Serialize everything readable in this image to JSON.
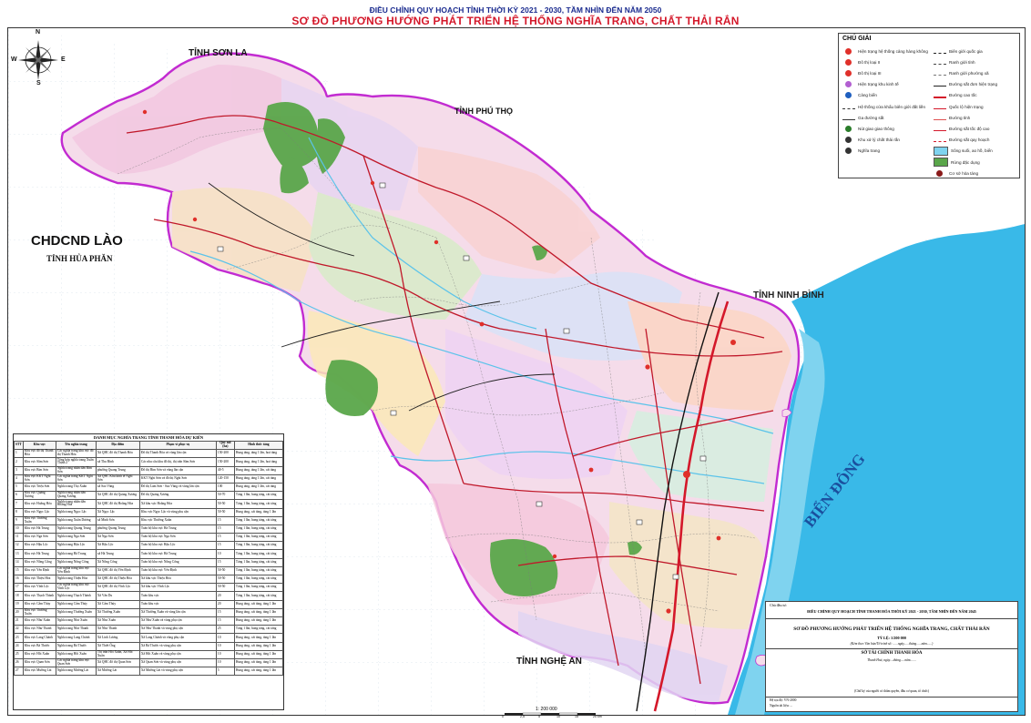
{
  "header": {
    "title": "ĐIỀU CHỈNH QUY HOẠCH TỈNH THỜI KỲ 2021 - 2030, TẦM NHÌN ĐẾN NĂM 2050",
    "subtitle": "SƠ ĐỒ PHƯƠNG HƯỚNG PHÁT TRIỂN HỆ THỐNG NGHĨA TRANG, CHẤT THẢI RẮN"
  },
  "map_labels": {
    "son_la": "TỈNH SƠN LA",
    "phu_tho": "TỈNH PHÚ THỌ",
    "lao": "CHDCND LÀO",
    "hua_phan": "TỈNH HỦA PHĂN",
    "ninh_binh": "TỈNH NINH BÌNH",
    "nghe_an": "TỈNH NGHỆ AN",
    "bien_dong": "BIỂN ĐÔNG"
  },
  "compass": {
    "n": "N",
    "s": "S",
    "e": "E",
    "w": "W"
  },
  "legend": {
    "heading": "CHÚ GIẢI",
    "items_left": [
      {
        "label": "Hiện trạng hệ thống cảng hàng không",
        "icon": "airport-icon",
        "color": "#e0302a"
      },
      {
        "label": "Đô thị loại II",
        "icon": "urban-type-ii-icon",
        "color": "#e0302a"
      },
      {
        "label": "Đô thị loại III",
        "icon": "urban-type-iii-icon",
        "color": "#e0302a"
      },
      {
        "label": "Hiện trạng khu kinh tế",
        "icon": "economic-zone-icon",
        "color": "#b25fd1"
      },
      {
        "label": "Cảng biển",
        "icon": "seaport-icon",
        "color": "#1f5fbf"
      },
      {
        "label": "Hệ thống cửa khẩu biên giới đất liền",
        "icon": "border-gate-icon",
        "color": "#333333"
      },
      {
        "label": "Ga đường sắt",
        "icon": "railway-station-icon",
        "color": "#333333"
      },
      {
        "label": "Nút giao giao thông",
        "icon": "interchange-icon",
        "color": "#2a7d2a"
      },
      {
        "label": "Khu xử lý chất thải rắn",
        "icon": "waste-treatment-icon",
        "color": "#333333"
      },
      {
        "label": "Nghĩa trang",
        "icon": "cemetery-icon",
        "color": "#333333"
      }
    ],
    "items_right": [
      {
        "label": "Biên giới quốc gia",
        "icon": "national-border-icon",
        "color": "#222222"
      },
      {
        "label": "Ranh giới tỉnh",
        "icon": "province-border-icon",
        "color": "#444444"
      },
      {
        "label": "Ranh giới phường xã",
        "icon": "commune-border-icon",
        "color": "#777777"
      },
      {
        "label": "Đường sắt đơn hiện trạng",
        "icon": "single-railway-icon",
        "color": "#222222"
      },
      {
        "label": "Đường cao tốc",
        "icon": "expressway-icon",
        "color": "#d4182a"
      },
      {
        "label": "Quốc lộ hiện trạng",
        "icon": "national-road-icon",
        "color": "#d4182a"
      },
      {
        "label": "Đường tỉnh",
        "icon": "provincial-road-icon",
        "color": "#e05050"
      },
      {
        "label": "Đường sắt tốc độ cao",
        "icon": "high-speed-rail-icon",
        "color": "#d4182a"
      },
      {
        "label": "Đường sắt quy hoạch",
        "icon": "planned-railway-icon",
        "color": "#d4182a"
      },
      {
        "label": "Sông suối, ao hồ, biển",
        "icon": "water-icon",
        "color": "#7fd3ef"
      },
      {
        "label": "Rừng đặc dụng",
        "icon": "special-forest-icon",
        "color": "#5aa64a"
      },
      {
        "label": "Cơ sở hỏa táng",
        "icon": "crematorium-icon",
        "color": "#8a1a1a"
      }
    ]
  },
  "cemetery_table": {
    "caption": "DANH MỤC NGHĨA TRANG TỈNH THANH HÓA DỰ KIẾN",
    "headers": [
      "STT",
      "Khu vực",
      "Tên nghĩa trang",
      "Địa điểm",
      "Phạm vi phục vụ",
      "Quy mô (ha)",
      "Hình thức táng"
    ],
    "rows": [
      [
        "1",
        "Khu vực đô thị Thanh Hóa",
        "Các nghĩa trang khu vực đô thị Thanh Hóa",
        "Xã QHC đô thị Thanh Hóa",
        "Đô thị Thanh Hóa và vùng lân cận",
        "150-200",
        "Hung táng, táng 1 lần, hoả táng"
      ],
      [
        "2",
        "Khu vực Sầm Sơn",
        "Tổng hợp nghĩa trang Xuân Thịnh 2",
        "xã Thu Bình",
        "Các nhu cầu khu đô thị, thị trấn Sầm Sơn",
        "150-200",
        "Hung táng, táng 1 lần, hoả táng"
      ],
      [
        "3",
        "Khu vực Bỉm Sơn",
        "Nghĩa trang nhân dân Bỉm Sơn",
        "phường Quang Trung",
        "Đô thị Bỉm Sơn và vùng lân cận",
        "40-5",
        "Hung táng, táng 1 lần, cát táng"
      ],
      [
        "4",
        "Khu vực KKT Nghi Sơn",
        "Các nghĩa trang KKT Nghi Sơn",
        "Xã QHC Khu kinh tế Nghi Sơn",
        "KKT Nghi Sơn và đô thị Nghi Sơn",
        "120-150",
        "Hung táng, táng 1 lần, cát táng"
      ],
      [
        "5",
        "Khu vực Triệu Sơn",
        "Nghĩa trang Thọ Xuân",
        "xã Sao Vàng",
        "Đô thị Lam Sơn - Sao Vàng và vùng lân cận",
        "100",
        "Hung táng, táng 1 lần, cát táng"
      ],
      [
        "6",
        "Khu vực Quảng Xương",
        "Nghĩa trang nhân dân Quảng Xương",
        "Xã QHC đô thị Quảng Xương",
        "Đô thị Quảng Xương",
        "50-70",
        "Táng 1 lần, hung táng, cát táng"
      ],
      [
        "7",
        "Khu vực Hoằng Hóa",
        "Nghĩa trang nhân dân Hoằng Hóa",
        "Xã QHC đô thị Hoằng Hóa",
        "Xã khu vực Hoằng Hóa",
        "50-50",
        "Táng 1 lần, hung táng, cát táng"
      ],
      [
        "8",
        "Khu vực Ngọc Lặc",
        "Nghĩa trang Ngọc Lặc",
        "Xã Ngọc Lặc",
        "Khu vực Ngọc Lặc và vùng phụ cận",
        "50-50",
        "Hung táng, cát táng, táng 1 lần"
      ],
      [
        "9",
        "Khu vực Thường Xuân",
        "Nghĩa trang Xuân Dương",
        "xã Minh Sơn",
        "Khu vực Thường Xuân",
        "15",
        "Táng 1 lần, hung táng, cát táng"
      ],
      [
        "10",
        "Khu vực Hà Trung",
        "Nghĩa trang Quang Trung",
        "phường Quang Trung",
        "Toàn bộ khu vực Hà Trung",
        "15",
        "Táng 1 lần, hung táng, cát táng"
      ],
      [
        "11",
        "Khu vực Nga Sơn",
        "Nghĩa trang Nga Sơn",
        "Xã Nga Sơn",
        "Toàn bộ khu vực Nga Sơn",
        "15",
        "Táng 1 lần, hung táng, cát táng"
      ],
      [
        "12",
        "Khu vực Hậu Lộc",
        "Nghĩa trang Hậu Lộc",
        "Xã Hậu Lộc",
        "Toàn bộ khu vực Hậu Lộc",
        "15",
        "Táng 1 lần, hung táng, cát táng"
      ],
      [
        "13",
        "Khu vực Hà Trung",
        "Nghĩa trang Hà Trung",
        "xã Hà Trung",
        "Toàn bộ khu vực Hà Trung",
        "10",
        "Táng 1 lần, hung táng, cát táng"
      ],
      [
        "14",
        "Khu vực Nông Cống",
        "Nghĩa trang Nông Cống",
        "Xã Nông Cống",
        "Toàn bộ khu vực Nông Cống",
        "15",
        "Táng 1 lần, hung táng, cát táng"
      ],
      [
        "15",
        "Khu vực Yên Định",
        "Các nghĩa trang khu vực Yên Định",
        "Xã QHC đô thị Yên Định",
        "Toàn bộ khu vực Yên Định",
        "50-50",
        "Táng 1 lần, hung táng, cát táng"
      ],
      [
        "16",
        "Khu vực Thiệu Hóa",
        "Nghĩa trang Thiệu Hóa",
        "Xã QHC đô thị Thiệu Hóa",
        "Xã khu vực Thiệu Hóa",
        "50-50",
        "Táng 1 lần, hung táng, cát táng"
      ],
      [
        "17",
        "Khu vực Vĩnh Lộc",
        "Các nghĩa trang khu vực Vĩnh Lộc",
        "Xã QHC đô thị Vĩnh Lộc",
        "Xã khu vực Vĩnh Lộc",
        "50-50",
        "Táng 1 lần, hung táng, cát táng"
      ],
      [
        "18",
        "Khu vực Thạch Thành",
        "Nghĩa trang Thạch Thành",
        "Xã Vân Du",
        "Toàn khu vực",
        "20",
        "Táng 1 lần, hung táng, cát táng"
      ],
      [
        "19",
        "Khu vực Cẩm Thủy",
        "Nghĩa trang Cẩm Thủy",
        "Xã Cẩm Thủy",
        "Toàn khu vực",
        "20",
        "Hung táng, cát táng, táng 1 lần"
      ],
      [
        "20",
        "Khu vực Thường Xuân",
        "Nghĩa trang Thường Xuân",
        "Xã Thường Xuân",
        "Xã Thường Xuân và vùng lân cận",
        "15",
        "Hung táng, cát táng, táng 1 lần"
      ],
      [
        "21",
        "Khu vực Như Xuân",
        "Nghĩa trang Như Xuân",
        "Xã Như Xuân",
        "Xã Như Xuân và vùng phụ cận",
        "15",
        "Hung táng, cát táng, táng 1 lần"
      ],
      [
        "22",
        "Khu vực Như Thanh",
        "Nghĩa trang Như Thanh",
        "Xã Như Thanh",
        "Xã Như Thanh và vùng phụ cận",
        "25",
        "Táng 1 lần, hung táng, cát táng"
      ],
      [
        "23",
        "Khu vực Lang Chánh",
        "Nghĩa trang Lang Chánh",
        "Xã Linh Lương",
        "Xã Lang Chánh và vùng phụ cận",
        "10",
        "Hung táng, cát táng, táng 1 lần"
      ],
      [
        "24",
        "Khu vực Bá Thước",
        "Nghĩa trang Bá Thước",
        "Xã Thiết Ống",
        "Xã Bá Thước và vùng phụ cận",
        "10",
        "Hung táng, cát táng, táng 1 lần"
      ],
      [
        "25",
        "Khu vực Hồi Xuân",
        "Nghĩa trang Hồi Xuân",
        "Thị trấn Hồi Xuân, Xã Hồi Xuân",
        "Xã Hồi Xuân và vùng phụ cận",
        "10",
        "Hung táng, cát táng, táng 1 lần"
      ],
      [
        "26",
        "Khu vực Quan Sơn",
        "Các nghĩa trang khu vực Quan Sơn",
        "Xã QHC đô thị Quan Sơn",
        "Xã Quan Sơn và vùng phụ cận",
        "10",
        "Hung táng, cát táng, táng 1 lần"
      ],
      [
        "27",
        "Khu vực Mường Lát",
        "Nghĩa trang Mường Lát",
        "Xã Mường Lát",
        "Xã Mường Lát và vùng phụ cận",
        "5",
        "Hung táng, cát táng, táng 1 lần"
      ]
    ]
  },
  "title_block": {
    "client": "Chủ đầu tư:",
    "project": "ĐIỀU CHỈNH QUY HOẠCH TỈNH THANH HÓA THỜI KỲ 2021 - 2030, TẦM NHÌN ĐẾN NĂM 2045",
    "drawing_title": "SƠ ĐỒ PHƯƠNG HƯỚNG PHÁT TRIỂN HỆ THỐNG NGHĨA TRANG, CHẤT THẢI RẮN",
    "scale": "TỶ LỆ: 1/200 000",
    "approval_note": "(Kèm theo Văn bản/Tờ trình số: ......ngày......tháng......năm......)",
    "agency": "SỞ TÀI CHÍNH THANH HÓA",
    "place_date": "Thanh Hoá, ngày....tháng.....năm.......",
    "signature_note": "(Chữ ký của người có thẩm quyền, đầu cơ quan, tổ chức)",
    "footer_1": "Hệ tọa độ: VN-2000",
    "footer_2": "Nguồn tài liệu: ..."
  },
  "scale_bar": {
    "label": "1: 200 000",
    "ticks": [
      "0",
      "2,5",
      "5",
      "10",
      "15",
      "20 km"
    ]
  },
  "colors": {
    "sea": "#39b9e8",
    "sea_light": "#7fd3ef",
    "forest": "#5aa64a",
    "province_boundary": "#c22bd1",
    "expressway": "#d4182a",
    "road": "#c0182a",
    "railway": "#111111"
  }
}
